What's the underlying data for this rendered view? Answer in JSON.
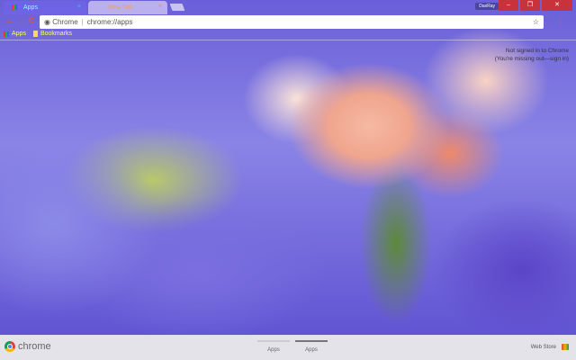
{
  "tabs": [
    {
      "label": "Apps",
      "close": "×"
    },
    {
      "label": "New Tab",
      "close": "×"
    }
  ],
  "window": {
    "user": "DaxRay",
    "minimize": "–",
    "restore": "❐",
    "close": "✕"
  },
  "toolbar": {
    "back": "←",
    "forward": "→",
    "reload": "C",
    "site_label": "Chrome",
    "url": "chrome://apps",
    "star": "☆",
    "menu": "⋮"
  },
  "bookmarks": [
    {
      "label": "Apps"
    },
    {
      "label": "Bookmarks"
    }
  ],
  "signin": {
    "line1": "Not signed in to Chrome",
    "line2": "(You're missing out—sign in)"
  },
  "bottom": {
    "logo": "chrome",
    "pages": [
      "Apps",
      "Apps"
    ],
    "webstore": "Web Store"
  }
}
